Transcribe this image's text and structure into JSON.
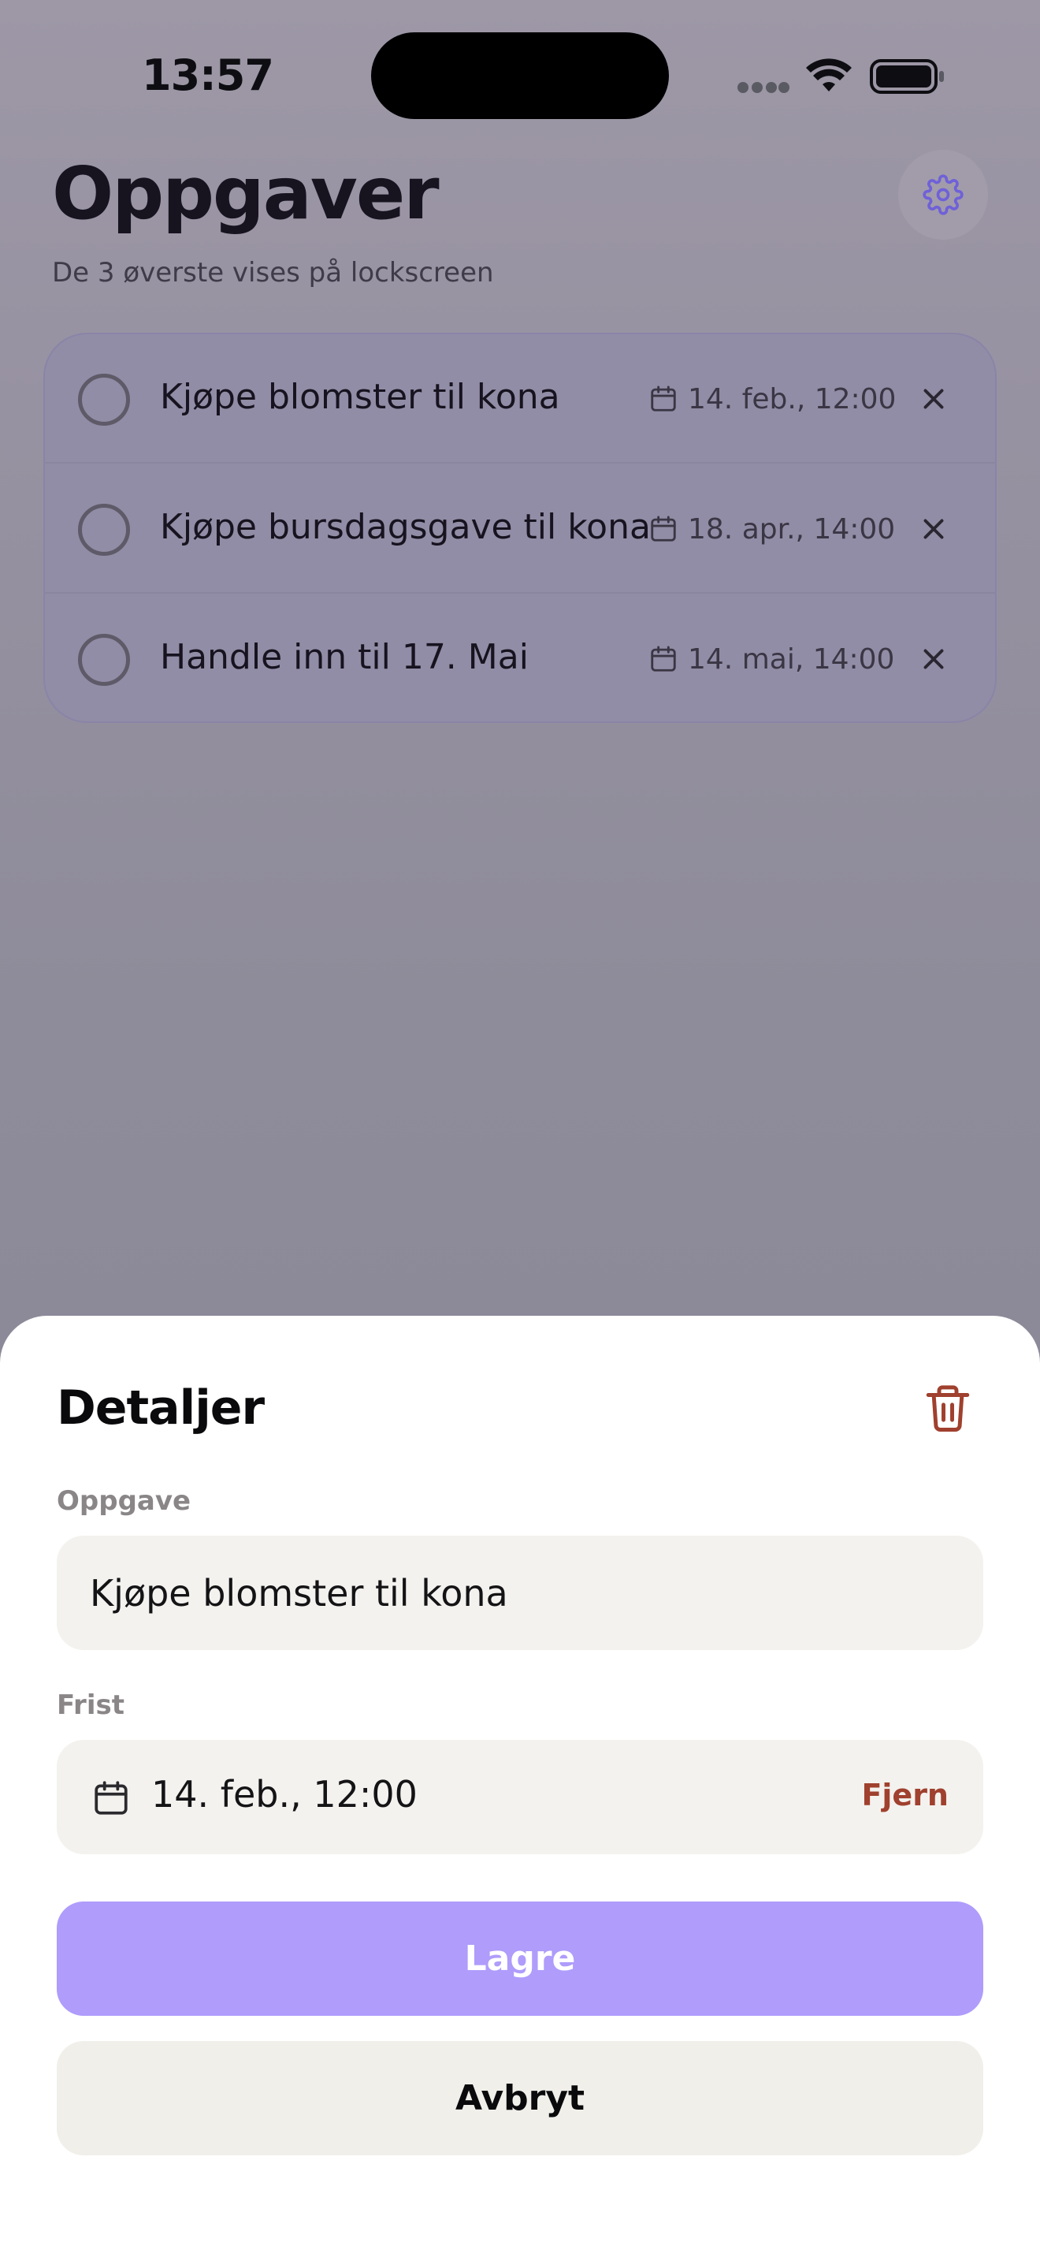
{
  "status_bar": {
    "time": "13:57"
  },
  "header": {
    "title": "Oppgaver",
    "subtitle": "De 3 øverste vises på lockscreen",
    "settings_icon": "gear-icon"
  },
  "tasks": [
    {
      "title": "Kjøpe blomster til kona",
      "due": "14. feb., 12:00",
      "done": false
    },
    {
      "title": "Kjøpe bursdagsgave til kona",
      "due": "18. apr., 14:00",
      "done": false
    },
    {
      "title": "Handle inn til 17. Mai",
      "due": "14. mai, 14:00",
      "done": false
    }
  ],
  "sheet": {
    "title": "Detaljer",
    "task_label": "Oppgave",
    "task_value": "Kjøpe blomster til kona",
    "deadline_label": "Frist",
    "deadline_value": "14. feb., 12:00",
    "remove_label": "Fjern",
    "save_label": "Lagre",
    "cancel_label": "Avbryt"
  },
  "colors": {
    "accent": "#af9cfb",
    "danger": "#a0402e",
    "field_bg": "#f3f2ee",
    "overlay": "#8a8a97"
  }
}
